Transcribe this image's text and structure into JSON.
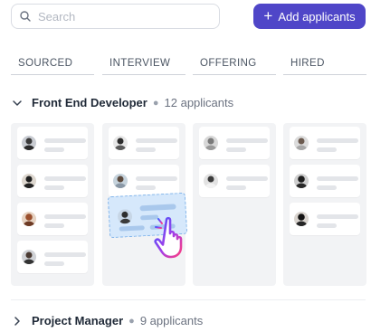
{
  "search": {
    "placeholder": "Search",
    "value": ""
  },
  "toolbar": {
    "add_label": "Add applicants"
  },
  "stages": [
    "SOURCED",
    "INTERVIEW",
    "OFFERING",
    "HIRED"
  ],
  "groups": [
    {
      "title": "Front End Developer",
      "count": "12 applicants",
      "expanded": true
    },
    {
      "title": "Project Manager",
      "count": "9 applicants",
      "expanded": false
    }
  ],
  "board": {
    "columns": [
      {
        "stage": "SOURCED",
        "cards": 4
      },
      {
        "stage": "INTERVIEW",
        "cards": 2
      },
      {
        "stage": "OFFERING",
        "cards": 2
      },
      {
        "stage": "HIRED",
        "cards": 3
      }
    ]
  },
  "colors": {
    "accent": "#4f46c8",
    "drag_card": "#d6e8fb",
    "column_bg": "#f2f3f5"
  },
  "icons": {
    "search": "search-icon",
    "add": "plus-icon",
    "cursor": "hand-pointer-icon"
  }
}
